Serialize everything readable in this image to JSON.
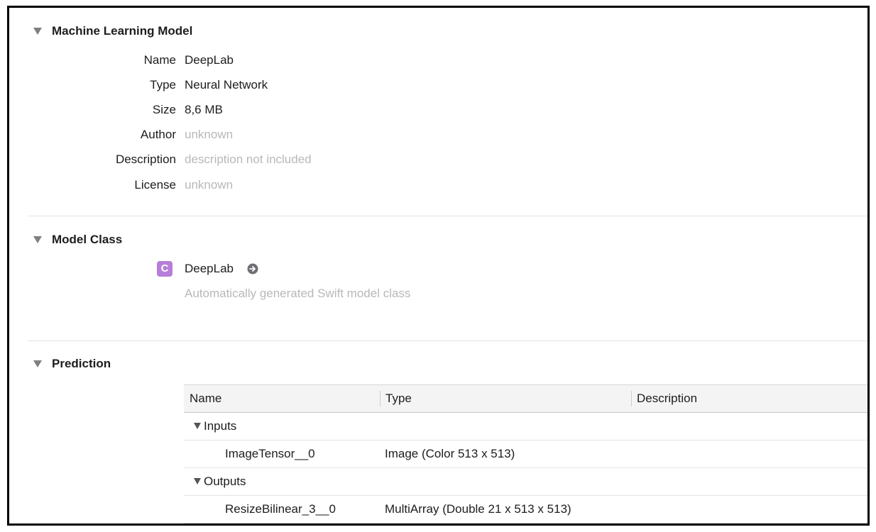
{
  "ml_model": {
    "title": "Machine Learning Model",
    "properties": [
      {
        "label": "Name",
        "value": "DeepLab",
        "muted": false
      },
      {
        "label": "Type",
        "value": "Neural Network",
        "muted": false
      },
      {
        "label": "Size",
        "value": "8,6 MB",
        "muted": false
      },
      {
        "label": "Author",
        "value": "unknown",
        "muted": true
      },
      {
        "label": "Description",
        "value": "description not included",
        "muted": true
      },
      {
        "label": "License",
        "value": "unknown",
        "muted": true
      }
    ]
  },
  "model_class": {
    "title": "Model Class",
    "badge": "C",
    "badge_color": "#b77ed9",
    "class_name": "DeepLab",
    "goto_icon": "arrow-circle-right-icon",
    "description": "Automatically generated Swift model class"
  },
  "prediction": {
    "title": "Prediction",
    "columns": [
      "Name",
      "Type",
      "Description"
    ],
    "groups": [
      {
        "label": "Inputs",
        "rows": [
          {
            "name": "ImageTensor__0",
            "type": "Image (Color 513 x 513)",
            "description": ""
          }
        ]
      },
      {
        "label": "Outputs",
        "rows": [
          {
            "name": "ResizeBilinear_3__0",
            "type": "MultiArray (Double 21 x 513 x 513)",
            "description": ""
          }
        ]
      }
    ]
  },
  "colors": {
    "text": "#1d1d1f",
    "muted_text": "#b8b8bc",
    "disclosure": "#808080",
    "divider": "#e3e3e3"
  }
}
